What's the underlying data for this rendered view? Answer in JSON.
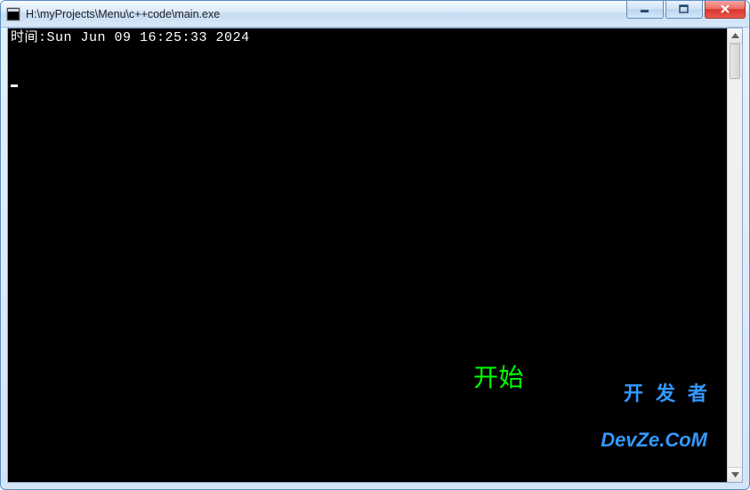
{
  "window": {
    "title": "H:\\myProjects\\Menu\\c++code\\main.exe"
  },
  "console": {
    "time_label": "时间",
    "time_value": "Sun Jun 09 16:25:33 2024",
    "start_label": "开始"
  },
  "watermark": {
    "line1": "开发者",
    "line2": "DevZe.CoM"
  },
  "colors": {
    "console_bg": "#000000",
    "console_fg": "#ffffff",
    "start_fg": "#00ff00",
    "watermark_fg": "#3399ff",
    "titlebar_from": "#f4f9ff",
    "titlebar_to": "#d8e8f8",
    "close_from": "#f7a6a1",
    "close_to": "#e9584e"
  }
}
